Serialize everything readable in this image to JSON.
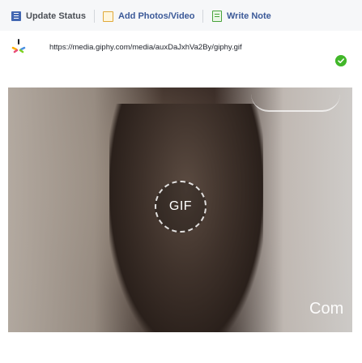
{
  "composer": {
    "tabs": [
      {
        "label": "Update Status",
        "icon": "status-icon",
        "active": true
      },
      {
        "label": "Add Photos/Video",
        "icon": "photo-icon",
        "active": false
      },
      {
        "label": "Write Note",
        "icon": "note-icon",
        "active": false
      }
    ]
  },
  "link_preview": {
    "url": "https://media.giphy.com/media/auxDaJxhVa2By/giphy.gif",
    "logo_icon": "giphy-logo-icon",
    "status_icon": "check-circle-icon"
  },
  "gif": {
    "badge_text": "GIF",
    "partial_text": "Com"
  },
  "colors": {
    "link_blue": "#3b5998",
    "ok_green": "#42b72a"
  }
}
